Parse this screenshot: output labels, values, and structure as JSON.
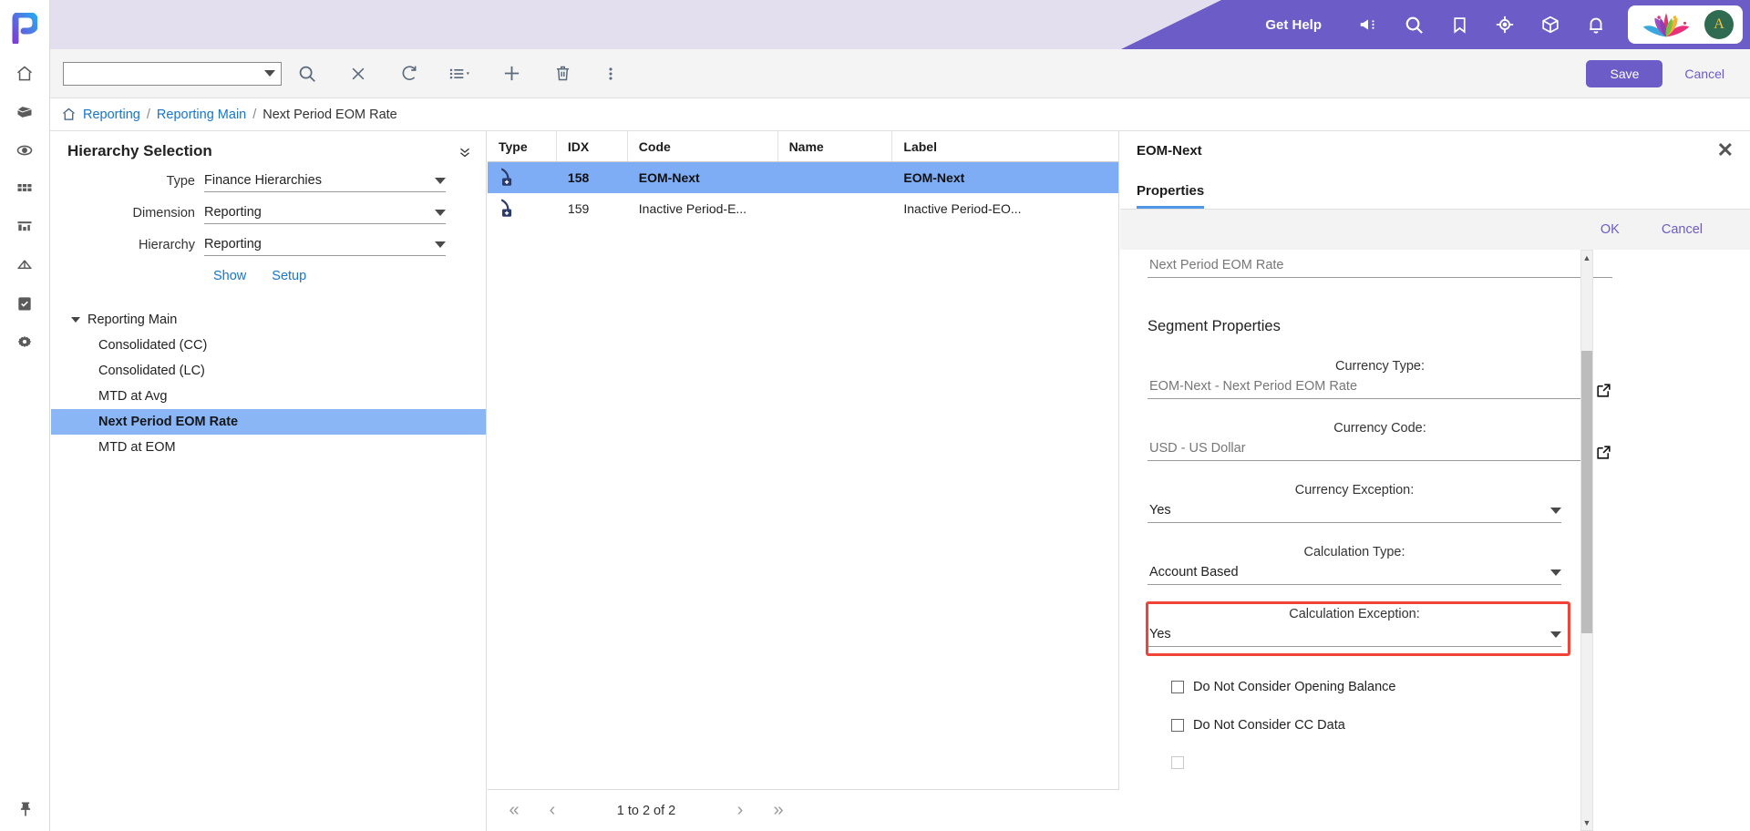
{
  "brand": {
    "logo_letter": "P",
    "accent": "#6c5cc7",
    "header_bg": "#e4dfee"
  },
  "header": {
    "get_help": "Get Help",
    "icons": [
      "megaphone-icon",
      "search-icon",
      "bookmark-icon",
      "target-icon",
      "cube-icon",
      "bell-icon"
    ],
    "avatar_letter": "A"
  },
  "toolbar": {
    "combo_value": "",
    "combo_placeholder": "",
    "icons": [
      "search-icon",
      "clear-icon",
      "refresh-icon",
      "list-view-icon",
      "add-icon",
      "delete-icon",
      "more-icon"
    ],
    "save_label": "Save",
    "cancel_label": "Cancel"
  },
  "breadcrumb": {
    "home_icon": "home-icon",
    "items": [
      "Reporting",
      "Reporting Main",
      "Next Period EOM Rate"
    ],
    "separator": "/"
  },
  "hierarchy_panel": {
    "title": "Hierarchy Selection",
    "fields": [
      {
        "label": "Type",
        "value": "Finance Hierarchies"
      },
      {
        "label": "Dimension",
        "value": "Reporting"
      },
      {
        "label": "Hierarchy",
        "value": "Reporting"
      }
    ],
    "links": [
      "Show",
      "Setup"
    ],
    "tree": [
      {
        "label": "Reporting Main",
        "level": 0,
        "expanded": true,
        "selected": false
      },
      {
        "label": "Consolidated (CC)",
        "level": 1,
        "expanded": false,
        "selected": false
      },
      {
        "label": "Consolidated (LC)",
        "level": 1,
        "expanded": false,
        "selected": false
      },
      {
        "label": "MTD at Avg",
        "level": 1,
        "expanded": false,
        "selected": false
      },
      {
        "label": "Next Period EOM Rate",
        "level": 1,
        "expanded": false,
        "selected": true
      },
      {
        "label": "MTD at EOM",
        "level": 1,
        "expanded": false,
        "selected": false
      }
    ]
  },
  "grid": {
    "columns": [
      "Type",
      "IDX",
      "Code",
      "Name",
      "Label"
    ],
    "rows": [
      {
        "type_icon": "segment-add-icon",
        "idx": "158",
        "code": "EOM-Next",
        "name": "",
        "label": "EOM-Next",
        "selected": true
      },
      {
        "type_icon": "segment-add-icon",
        "idx": "159",
        "code": "Inactive Period-E...",
        "name": "",
        "label": "Inactive Period-EO...",
        "selected": false
      }
    ],
    "pagination": {
      "first": "«",
      "prev": "‹",
      "status": "1 to 2 of 2",
      "next": "›",
      "last": "»"
    }
  },
  "properties_panel": {
    "title": "EOM-Next",
    "close_icon": "close-icon",
    "tabs": [
      {
        "label": "Properties",
        "active": true
      }
    ],
    "actions": {
      "ok": "OK",
      "cancel": "Cancel"
    },
    "top_field_value": "Next Period EOM Rate",
    "section_title": "Segment Properties",
    "fields": [
      {
        "label": "Currency Type:",
        "value": "EOM-Next - Next Period EOM Rate",
        "control": "external-link",
        "muted": true
      },
      {
        "label": "Currency Code:",
        "value": "USD - US Dollar",
        "control": "external-link",
        "muted": true
      },
      {
        "label": "Currency Exception:",
        "value": "Yes",
        "control": "dropdown",
        "muted": false
      },
      {
        "label": "Calculation Type:",
        "value": "Account Based",
        "control": "dropdown",
        "muted": false
      },
      {
        "label": "Calculation Exception:",
        "value": "Yes",
        "control": "dropdown",
        "muted": false,
        "highlighted": true
      }
    ],
    "checkboxes": [
      {
        "label": "Do Not Consider Opening Balance",
        "checked": false
      },
      {
        "label": "Do Not Consider CC Data",
        "checked": false
      }
    ],
    "highlight_color": "#f04438"
  }
}
